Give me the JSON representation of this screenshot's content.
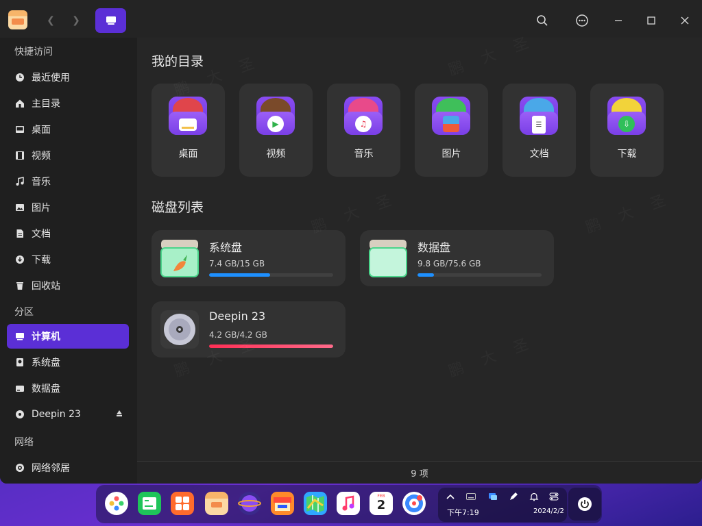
{
  "titlebar": {
    "app_icon": "file-manager-icon",
    "back_icon": "chevron-left-icon",
    "forward_icon": "chevron-right-icon",
    "view_icon": "monitor-icon",
    "search_icon": "search-icon",
    "menu_icon": "more-icon",
    "minimize_icon": "minimize-icon",
    "maximize_icon": "maximize-icon",
    "close_icon": "close-icon"
  },
  "sidebar": {
    "quick_access_title": "快捷访问",
    "quick_access": [
      {
        "label": "最近使用",
        "icon": "clock-icon"
      },
      {
        "label": "主目录",
        "icon": "home-icon"
      },
      {
        "label": "桌面",
        "icon": "desktop-icon"
      },
      {
        "label": "视频",
        "icon": "video-icon"
      },
      {
        "label": "音乐",
        "icon": "music-icon"
      },
      {
        "label": "图片",
        "icon": "image-icon"
      },
      {
        "label": "文档",
        "icon": "document-icon"
      },
      {
        "label": "下载",
        "icon": "download-icon"
      },
      {
        "label": "回收站",
        "icon": "trash-icon"
      }
    ],
    "partition_title": "分区",
    "partitions": [
      {
        "label": "计算机",
        "icon": "computer-icon",
        "active": true
      },
      {
        "label": "系统盘",
        "icon": "disk-icon"
      },
      {
        "label": "数据盘",
        "icon": "disk-icon"
      },
      {
        "label": "Deepin 23",
        "icon": "disc-icon",
        "eject": true
      }
    ],
    "network_title": "网络",
    "network": [
      {
        "label": "网络邻居",
        "icon": "network-icon"
      }
    ]
  },
  "main": {
    "my_dirs_title": "我的目录",
    "folders": [
      {
        "label": "桌面",
        "icon": "desktop-folder-icon",
        "color": "#e0454b"
      },
      {
        "label": "视频",
        "icon": "video-folder-icon",
        "color": "#7a4a2a"
      },
      {
        "label": "音乐",
        "icon": "music-folder-icon",
        "color": "#e84a8a"
      },
      {
        "label": "图片",
        "icon": "image-folder-icon",
        "color": "#3fbf5a"
      },
      {
        "label": "文档",
        "icon": "document-folder-icon",
        "color": "#4aa8e8"
      },
      {
        "label": "下载",
        "icon": "download-folder-icon",
        "color": "#f2d33a"
      }
    ],
    "disks_title": "磁盘列表",
    "disks": [
      {
        "name": "系统盘",
        "size": "7.4 GB/15 GB",
        "usage": 0.49,
        "color": "#1e90ff",
        "icon": "system-disk-icon"
      },
      {
        "name": "数据盘",
        "size": "9.8 GB/75.6 GB",
        "usage": 0.13,
        "color": "#1e90ff",
        "icon": "data-disk-icon"
      },
      {
        "name": "Deepin 23",
        "size": "4.2 GB/4.2 GB",
        "usage": 1.0,
        "color": "#ff2f55",
        "icon": "optical-disc-icon"
      }
    ],
    "status": "9 项"
  },
  "taskbar": {
    "apps": [
      "launcher-icon",
      "terminal-icon",
      "multitask-icon",
      "file-manager-icon",
      "browser-icon",
      "app-store-icon",
      "maps-icon",
      "music-icon",
      "calendar-icon",
      "deepin-browser-icon"
    ],
    "calendar_month": "FEB",
    "calendar_day": "2",
    "time": "下午7:19",
    "date": "2024/2/2"
  }
}
